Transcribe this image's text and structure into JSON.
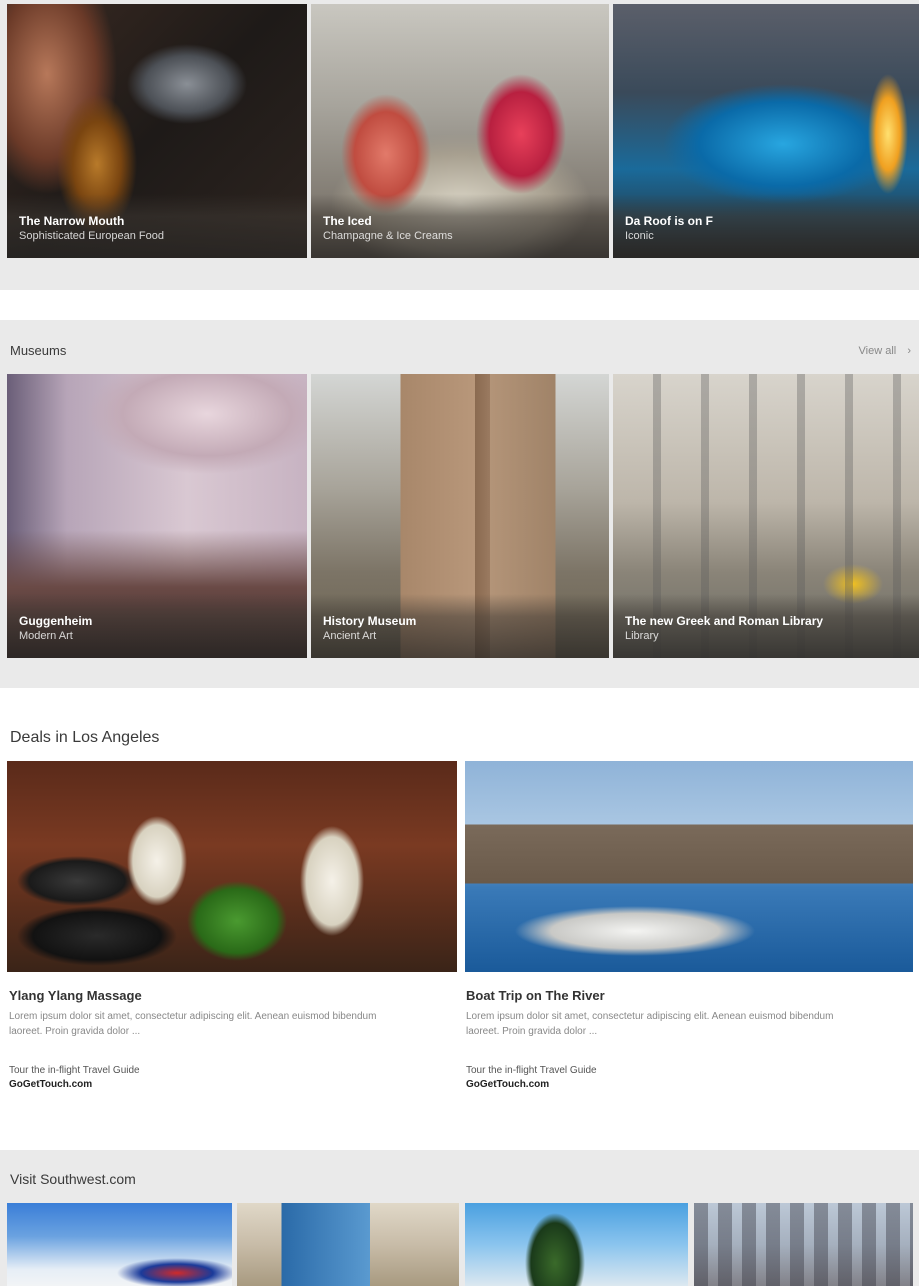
{
  "restaurants": {
    "tiles": [
      {
        "title": "The Narrow Mouth",
        "subtitle": "Sophisticated European Food"
      },
      {
        "title": "The Iced",
        "subtitle": "Champagne & Ice Creams"
      },
      {
        "title": "Da Roof is on F",
        "subtitle": "Iconic"
      }
    ]
  },
  "museums": {
    "heading": "Museums",
    "view_all": "View all",
    "tiles": [
      {
        "title": "Guggenheim",
        "subtitle": "Modern Art"
      },
      {
        "title": "History Museum",
        "subtitle": "Ancient Art"
      },
      {
        "title": "The new Greek and Roman Library",
        "subtitle": "Library"
      }
    ]
  },
  "deals": {
    "heading": "Deals in Los Angeles",
    "items": [
      {
        "title": "Ylang Ylang Massage",
        "description": "Lorem ipsum dolor sit amet, consectetur adipiscing elit. Aenean euismod bibendum laoreet. Proin gravida dolor ...",
        "source": "Tour the in-flight Travel Guide",
        "link": "GoGetTouch.com"
      },
      {
        "title": "Boat Trip on The River",
        "description": "Lorem ipsum dolor sit amet, consectetur adipiscing elit. Aenean euismod bibendum laoreet. Proin gravida dolor ...",
        "source": "Tour the in-flight Travel Guide",
        "link": "GoGetTouch.com"
      }
    ]
  },
  "southwest": {
    "heading": "Visit Southwest.com"
  }
}
